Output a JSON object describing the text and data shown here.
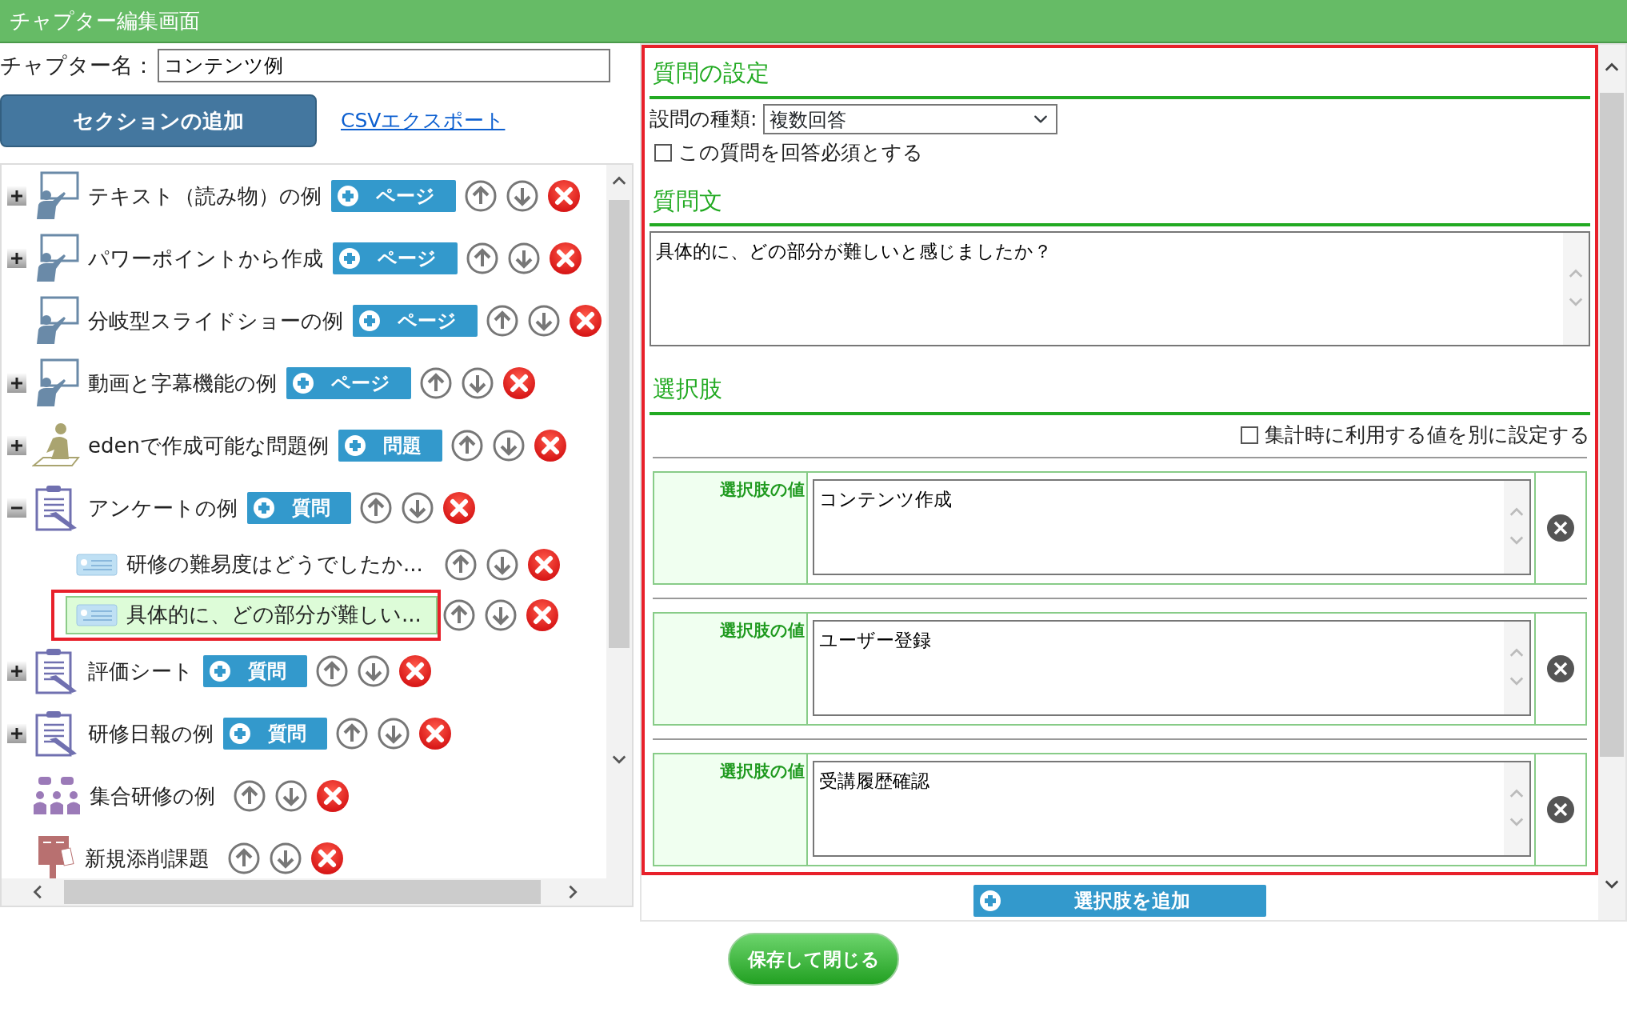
{
  "window": {
    "title": "チャプター編集画面"
  },
  "chapter_name": {
    "label": "チャプター名：",
    "value": "コンテンツ例"
  },
  "add_section_button": "セクションの追加",
  "csv_export_link": "CSVエクスポート",
  "tree": {
    "items": [
      {
        "label": "テキスト（読み物）の例",
        "kind": "slide",
        "expandable": true,
        "expanded": false,
        "add_button": "ページ"
      },
      {
        "label": "パワーポイントから作成",
        "kind": "slide",
        "expandable": true,
        "expanded": false,
        "add_button": "ページ"
      },
      {
        "label": "分岐型スライドショーの例",
        "kind": "slide",
        "expandable": false,
        "add_button": "ページ"
      },
      {
        "label": "動画と字幕機能の例",
        "kind": "slide",
        "expandable": true,
        "expanded": false,
        "add_button": "ページ"
      },
      {
        "label": "edenで作成可能な問題例",
        "kind": "exam",
        "expandable": true,
        "expanded": false,
        "add_button": "問題"
      },
      {
        "label": "アンケートの例",
        "kind": "survey",
        "expandable": true,
        "expanded": true,
        "add_button": "質問",
        "children": [
          {
            "label": "研修の難易度はどうでしたか...",
            "kind": "question",
            "selected": false
          },
          {
            "label": "具体的に、どの部分が難しい...",
            "kind": "question",
            "selected": true
          }
        ]
      },
      {
        "label": "評価シート",
        "kind": "survey",
        "expandable": true,
        "expanded": false,
        "add_button": "質問"
      },
      {
        "label": "研修日報の例",
        "kind": "survey",
        "expandable": true,
        "expanded": false,
        "add_button": "質問"
      },
      {
        "label": "集合研修の例",
        "kind": "group",
        "expandable": false
      },
      {
        "label": "新規添削課題",
        "kind": "post",
        "expandable": false
      }
    ]
  },
  "question_settings": {
    "heading": "質問の設定",
    "type_label": "設問の種類:",
    "type_value": "複数回答",
    "required": {
      "label": "この質問を回答必須とする",
      "checked": false
    }
  },
  "question_text": {
    "heading": "質問文",
    "value": "具体的に、どの部分が難しいと感じましたか？"
  },
  "choices": {
    "heading": "選択肢",
    "separate_value": {
      "label": "集計時に利用する値を別に設定する",
      "checked": false
    },
    "items": [
      {
        "label": "選択肢の値",
        "value": "コンテンツ作成"
      },
      {
        "label": "選択肢の値",
        "value": "ユーザー登録"
      },
      {
        "label": "選択肢の値",
        "value": "受講履歴確認"
      }
    ],
    "add_button": "選択肢を追加"
  },
  "save_button": "保存して閉じる"
}
